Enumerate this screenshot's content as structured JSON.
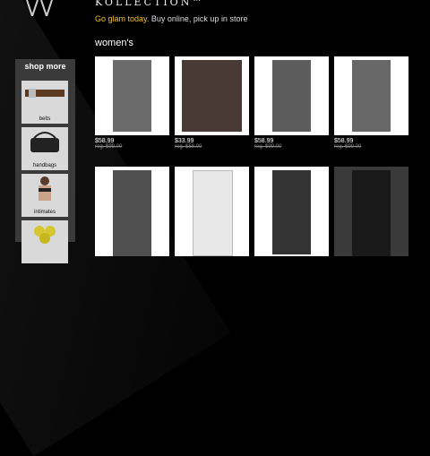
{
  "header": {
    "brand": "KOLLECTION™",
    "tagline_accent": "Go glam today.",
    "tagline_rest": "Buy online, pick up in store"
  },
  "section_title": "women's",
  "sidebar": {
    "title": "shop more",
    "items": [
      {
        "label": "belts"
      },
      {
        "label": "handbags"
      },
      {
        "label": "intimates"
      },
      {
        "label": ""
      }
    ]
  },
  "products_row1": [
    {
      "price": "$58.99",
      "reg": "reg. $99.00"
    },
    {
      "price": "$33.99",
      "reg": "reg. $58.00"
    },
    {
      "price": "$58.99",
      "reg": "reg. $99.00"
    },
    {
      "price": "$58.99",
      "reg": "reg. $99.00"
    }
  ],
  "colors": {
    "background": "#000000",
    "accent": "#f4c430",
    "sidebar": "#3a3a3a"
  }
}
